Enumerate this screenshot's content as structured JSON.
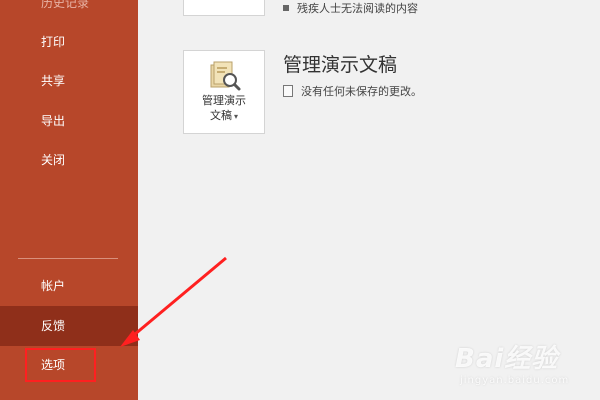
{
  "sidebar": {
    "items": [
      {
        "label": "历史记录"
      },
      {
        "label": "打印"
      },
      {
        "label": "共享"
      },
      {
        "label": "导出"
      },
      {
        "label": "关闭"
      },
      {
        "label": "帐户"
      },
      {
        "label": "反馈"
      },
      {
        "label": "选项"
      }
    ]
  },
  "main": {
    "inspect_bullet": "残疾人士无法阅读的内容",
    "manage": {
      "tile_label_line1": "管理演示",
      "tile_label_line2": "文稿",
      "title": "管理演示文稿",
      "status": "没有任何未保存的更改。"
    }
  },
  "watermark": {
    "main": "Bai经验",
    "sub": "jingyan.baidu.com"
  },
  "colors": {
    "sidebar_bg": "#b7472a",
    "sidebar_active": "#8f2f1a",
    "annotation": "#ff2020",
    "main_bg": "#f1f1f1"
  },
  "icons": {
    "manage_tile": "folder-magnifier-icon",
    "status": "document-icon",
    "caret": "caret-down-icon"
  }
}
